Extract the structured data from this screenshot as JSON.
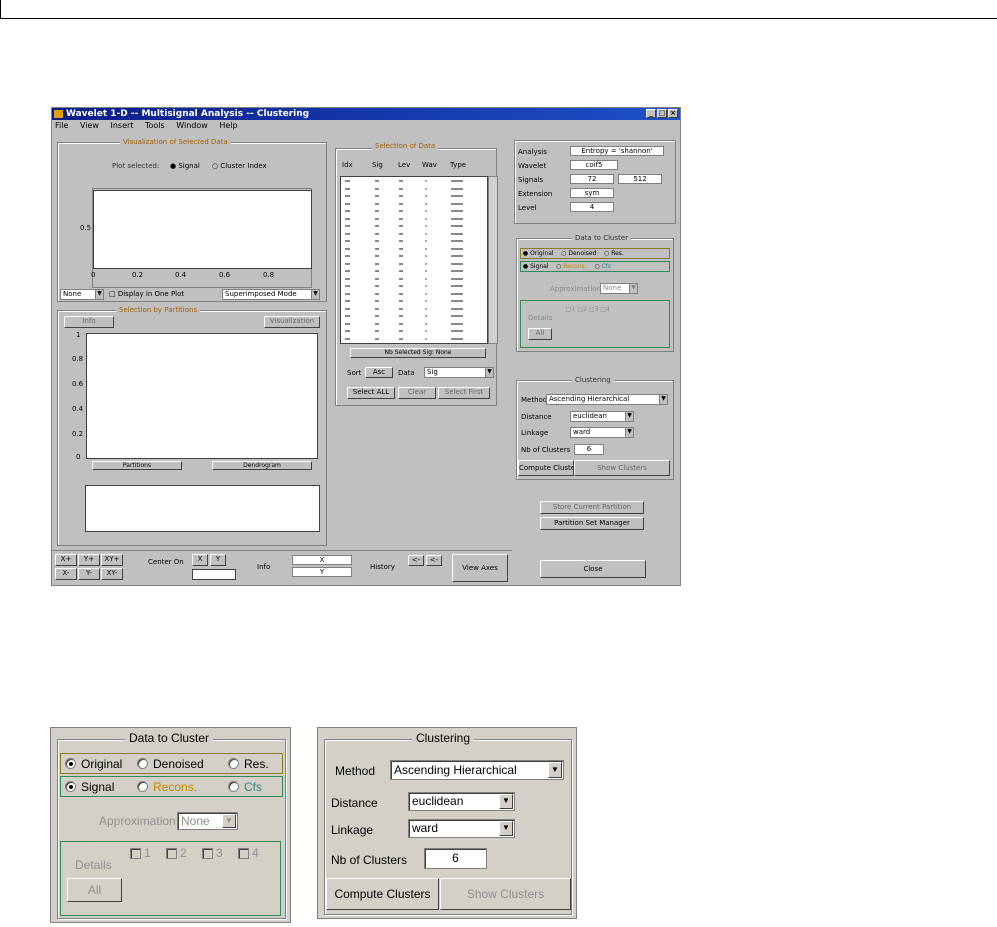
{
  "window": {
    "title": "Wavelet 1-D -- Multisignal Analysis -- Clustering",
    "controls": [
      "_",
      "□",
      "×"
    ],
    "menu": [
      "File",
      "View",
      "Insert",
      "Tools",
      "Window",
      "Help"
    ]
  },
  "visualization": {
    "title": "Visualization of Selected Data",
    "option_label": "Plot selected:",
    "option_a": "Signal",
    "option_b": "Cluster Index",
    "yticks": [
      "0.5"
    ],
    "xticks": [
      "0",
      "0.2",
      "0.4",
      "0.6",
      "0.8"
    ],
    "mode_value": "None",
    "checkbox_label": "Display in One Plot",
    "plot_mode_value": "Superimposed Mode"
  },
  "selection_panel": {
    "title": "Selection by Partitions",
    "left_button": "Info",
    "right_button": "Visualization",
    "yticks": [
      "1",
      "0.8",
      "0.6",
      "0.4",
      "0.2",
      "0"
    ],
    "x_left": "Partitions",
    "x_right": "Dendrogram"
  },
  "signals_table": {
    "title": "Selection of Data",
    "headers": [
      "Idx",
      "Sig",
      "Lev",
      "Wav",
      "Type"
    ],
    "status_label": "Nb Selected Sig: None",
    "sort_label": "Sort",
    "asc_label": "Asc",
    "select_label": "Data",
    "select_value": "Sig",
    "select_all": "Select ALL",
    "clear": "Clear",
    "import_first": "Select First"
  },
  "info_panel": {
    "rows": [
      {
        "label": "Analysis",
        "value": "Entropy = 'shannon'"
      },
      {
        "label": "Wavelet",
        "value": "coif5"
      },
      {
        "label": "Signals",
        "value": "72",
        "value2": "512"
      },
      {
        "label": "Extension",
        "value": "sym"
      },
      {
        "label": "Level",
        "value": "4"
      }
    ]
  },
  "data_to_cluster": {
    "title": "Data to Cluster",
    "row1": [
      "Original",
      "Denoised",
      "Res."
    ],
    "row2": [
      "Signal",
      "Recons.",
      "Cfs"
    ],
    "approx_label": "Approximation",
    "approx_value": "None",
    "details_label": "Details",
    "details": [
      "1",
      "2",
      "3",
      "4"
    ],
    "all_button": "All",
    "colors": {
      "recons": "#c88a00",
      "cfs": "#2a8c8c",
      "row2_border": "#2e8b57",
      "row1_border": "#8b7a28"
    }
  },
  "clustering": {
    "title": "Clustering",
    "method_label": "Method",
    "method_value": "Ascending Hierarchical",
    "distance_label": "Distance",
    "distance_value": "euclidean",
    "linkage_label": "Linkage",
    "linkage_value": "ward",
    "nb_label": "Nb of Clusters",
    "nb_value": "6",
    "compute_button": "Compute Clusters",
    "show_button": "Show Clusters"
  },
  "side_buttons": {
    "partition_button": "Store Current Partition",
    "manager_button": "Partition Set Manager",
    "close_button": "Close"
  },
  "bottom_bar": {
    "zoom_labels": [
      "X+",
      "Y+",
      "XY+",
      "X-",
      "Y-",
      "XY-"
    ],
    "center_label": "Center On",
    "center_x": "X",
    "center_y": "Y",
    "info_label": "Info",
    "info_top": "X",
    "info_bottom": "Y",
    "history_label": "History",
    "history_btns": [
      "<-",
      "<-"
    ],
    "view_axes": "View Axes"
  }
}
